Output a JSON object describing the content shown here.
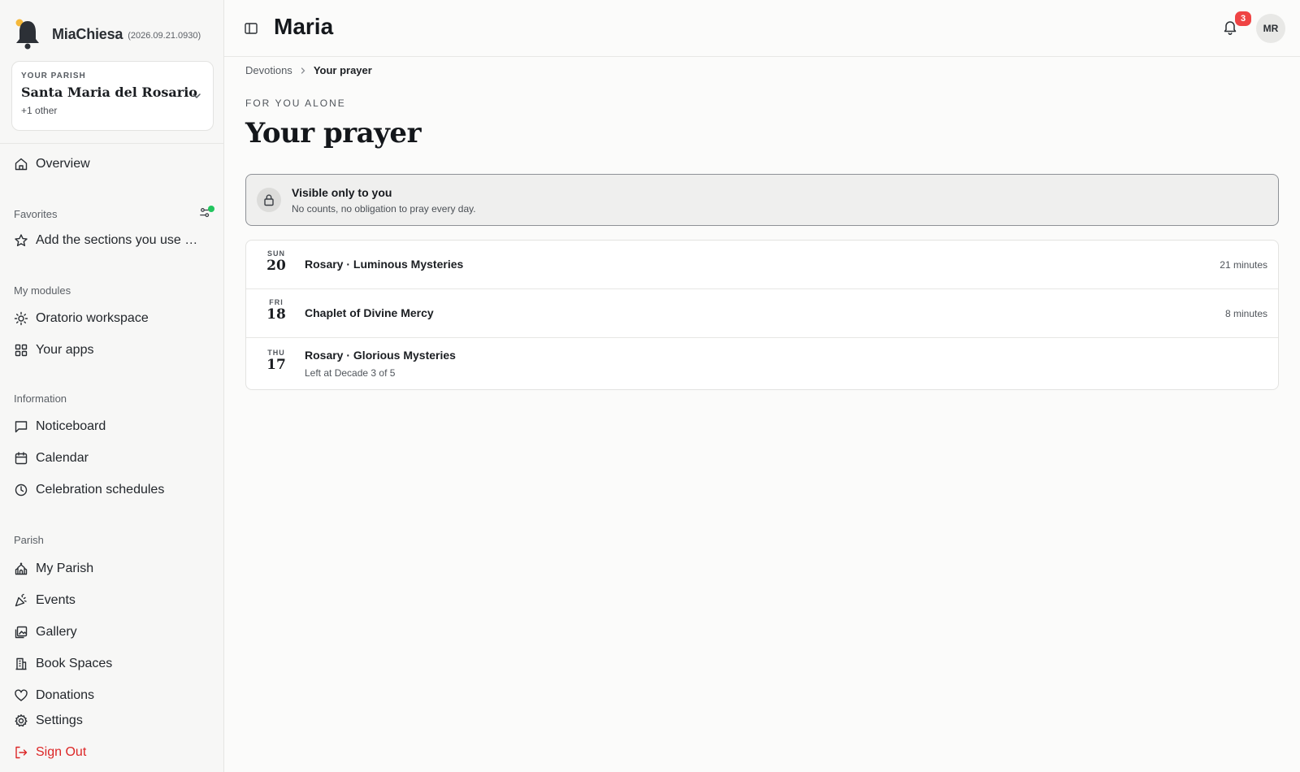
{
  "app": {
    "name": "MiaChiesa",
    "version": "(2026.09.21.0930)"
  },
  "parish": {
    "kicker": "YOUR PARISH",
    "name": "Santa Maria del Rosario",
    "other": "+1 other"
  },
  "sidebar": {
    "overview": "Overview",
    "favorites": {
      "label": "Favorites",
      "placeholder": "Add the sections you use most"
    },
    "modules": {
      "label": "My modules",
      "items": [
        "Oratorio workspace",
        "Your apps"
      ]
    },
    "information": {
      "label": "Information",
      "items": [
        "Noticeboard",
        "Calendar",
        "Celebration schedules"
      ]
    },
    "parish_section": {
      "label": "Parish",
      "items": [
        "My Parish",
        "Events",
        "Gallery",
        "Book Spaces",
        "Donations"
      ]
    },
    "settings": "Settings",
    "signout": "Sign Out"
  },
  "header": {
    "title": "Maria",
    "notifications": "3",
    "avatar": "MR"
  },
  "breadcrumb": {
    "parent": "Devotions",
    "current": "Your prayer"
  },
  "page": {
    "kicker": "FOR YOU ALONE",
    "title": "Your prayer",
    "notice": {
      "title": "Visible only to you",
      "subtitle": "No counts, no obligation to pray every day."
    }
  },
  "prayers": [
    {
      "dow": "SUN",
      "day": "20",
      "title": "Rosary · Luminous Mysteries",
      "duration": "21 minutes",
      "subtitle": ""
    },
    {
      "dow": "FRI",
      "day": "18",
      "title": "Chaplet of Divine Mercy",
      "duration": "8 minutes",
      "subtitle": ""
    },
    {
      "dow": "THU",
      "day": "17",
      "title": "Rosary · Glorious Mysteries",
      "duration": "",
      "subtitle": "Left at Decade 3 of 5"
    }
  ],
  "colors": {
    "accent_green": "#22c55e",
    "badge_red": "#ef4444",
    "signout_red": "#dc2626"
  }
}
